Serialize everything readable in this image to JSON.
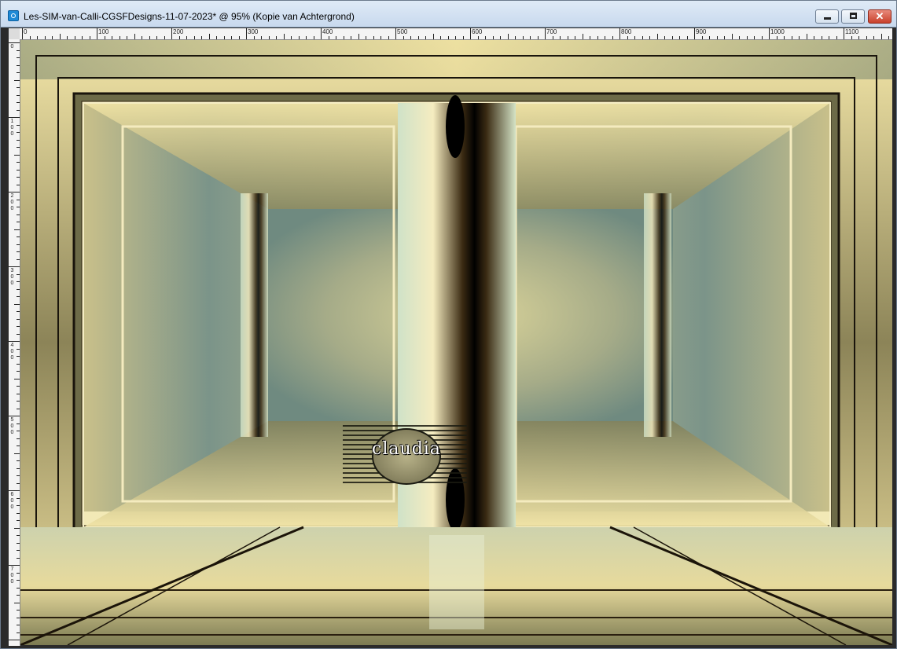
{
  "window": {
    "title": "Les-SIM-van-Calli-CGSFDesigns-11-07-2023* @  95% (Kopie van Achtergrond)",
    "app_icon": "paintshop-pro-icon",
    "controls": {
      "minimize": "minimize-icon",
      "maximize": "maximize-icon",
      "close": "close-icon"
    }
  },
  "ruler": {
    "horizontal_labels": [
      "0",
      "100",
      "200",
      "300",
      "400",
      "500",
      "600",
      "700",
      "800",
      "900",
      "1000",
      "1100"
    ],
    "vertical_labels": [
      "0",
      "100",
      "200",
      "300",
      "400",
      "500",
      "600",
      "700"
    ]
  },
  "canvas": {
    "layer_name": "Kopie van Achtergrond",
    "zoom": "95%",
    "colors": {
      "gold": "#e8d89a",
      "olive": "#8f8553",
      "teal": "#6f8f86",
      "dark": "#1a150c"
    }
  },
  "watermark": {
    "text": "claudia"
  }
}
